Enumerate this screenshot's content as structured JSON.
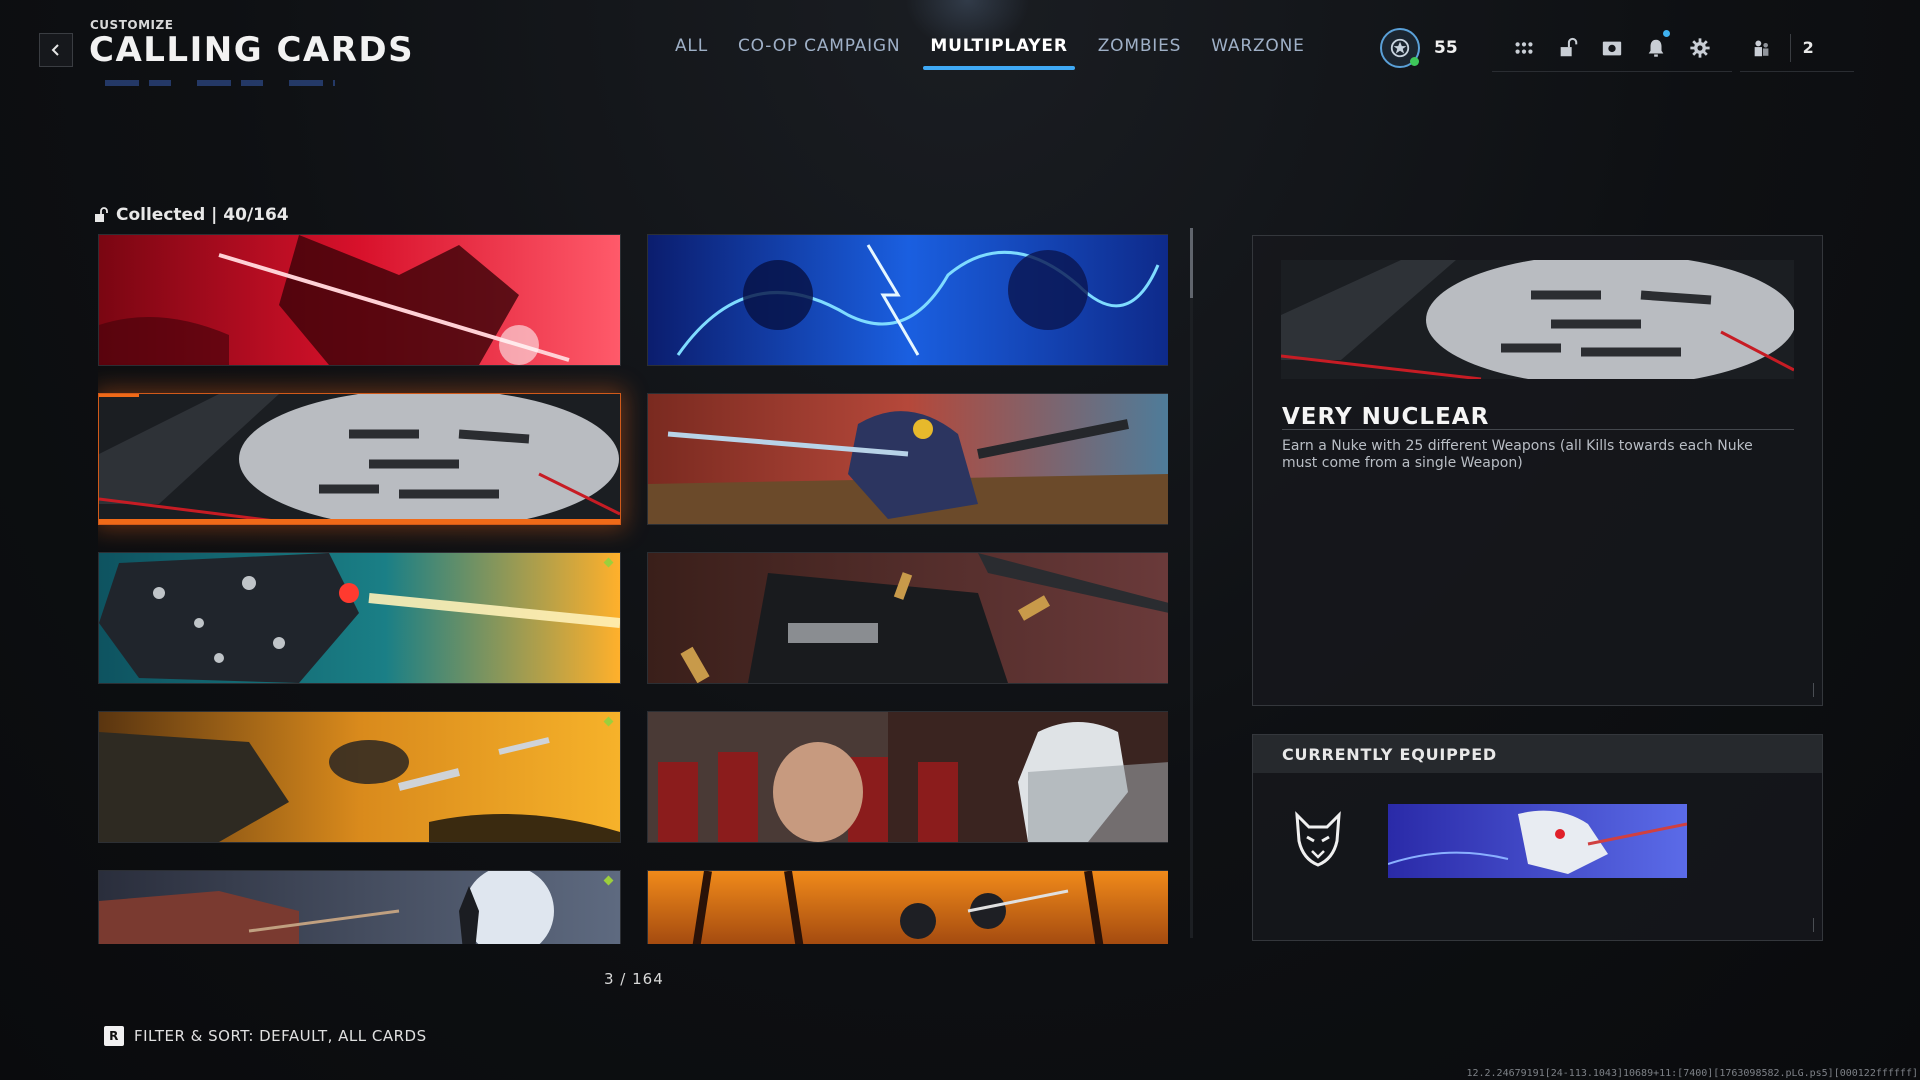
{
  "header": {
    "breadcrumb": "CUSTOMIZE",
    "title": "CALLING CARDS",
    "back_icon": "chevron-left-icon"
  },
  "tabs": [
    {
      "label": "ALL",
      "active": false
    },
    {
      "label": "CO-OP CAMPAIGN",
      "active": false
    },
    {
      "label": "MULTIPLAYER",
      "active": true
    },
    {
      "label": "ZOMBIES",
      "active": false
    },
    {
      "label": "WARZONE",
      "active": false
    }
  ],
  "hud": {
    "player_level": "55",
    "online_color": "#3ec75a",
    "icons": [
      "grid-menu-icon",
      "unlock-icon",
      "camera-icon",
      "bell-icon",
      "gear-icon"
    ],
    "party_count": "2"
  },
  "collection": {
    "collected_label": "Collected | 40/164",
    "counter": "3 / 164",
    "filter_key": "R",
    "filter_label": "FILTER & SORT: DEFAULT, ALL CARDS",
    "cards": [
      {
        "theme": "red-samurai-blade",
        "selected": false,
        "new": false
      },
      {
        "theme": "blue-lightning-beasts",
        "selected": false,
        "new": false
      },
      {
        "theme": "very-nuclear-weapons-nuke",
        "selected": true,
        "new": false
      },
      {
        "theme": "armored-knight-rifle",
        "selected": false,
        "new": false
      },
      {
        "theme": "diamond-robot-laser",
        "selected": false,
        "new": true
      },
      {
        "theme": "bullets-gun-closeup",
        "selected": false,
        "new": false
      },
      {
        "theme": "rocket-fire-sky",
        "selected": false,
        "new": true
      },
      {
        "theme": "old-master-ninjas",
        "selected": false,
        "new": false
      },
      {
        "theme": "moon-temple-ninja",
        "selected": false,
        "new": true
      },
      {
        "theme": "burning-dojo-ninjas",
        "selected": false,
        "new": false
      }
    ]
  },
  "detail": {
    "name": "VERY NUCLEAR",
    "description": "Earn a Nuke with 25 different Weapons (all Kills towards each Nuke must come from a single Weapon)"
  },
  "equipped": {
    "heading": "CURRENTLY EQUIPPED",
    "emblem_icon": "wolf-emblem-icon",
    "card_theme": "blue-skull-dragon"
  },
  "build_string": "12.2.24679191[24-113.1043]10689+11:[7400][1763098582.pLG.ps5][000122ffffff]",
  "colors": {
    "accent_blue": "#3fa9f5",
    "selection_orange": "#f06a18",
    "new_indicator": "#9ccf3c"
  }
}
